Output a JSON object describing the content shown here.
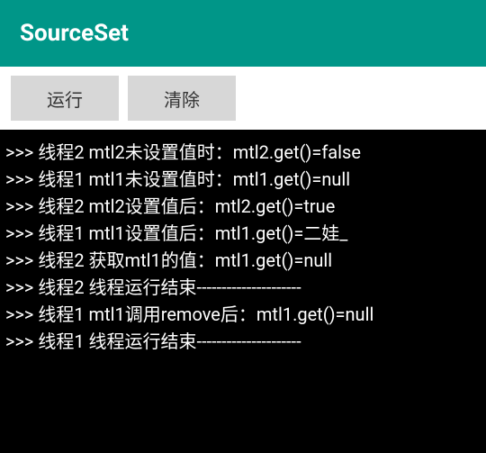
{
  "appbar": {
    "title": "SourceSet"
  },
  "buttons": {
    "run_label": "运行",
    "clear_label": "清除"
  },
  "console": {
    "lines": [
      ">>> 线程2 mtl2未设置值时：mtl2.get()=false",
      ">>> 线程1 mtl1未设置值时：mtl1.get()=null",
      ">>> 线程2 mtl2设置值后：mtl2.get()=true",
      ">>> 线程1 mtl1设置值后：mtl1.get()=二娃_",
      ">>> 线程2 获取mtl1的值：mtl1.get()=null",
      ">>> 线程2 线程运行结束---------------------",
      ">>> 线程1 mtl1调用remove后：mtl1.get()=null",
      ">>> 线程1 线程运行结束---------------------"
    ]
  }
}
